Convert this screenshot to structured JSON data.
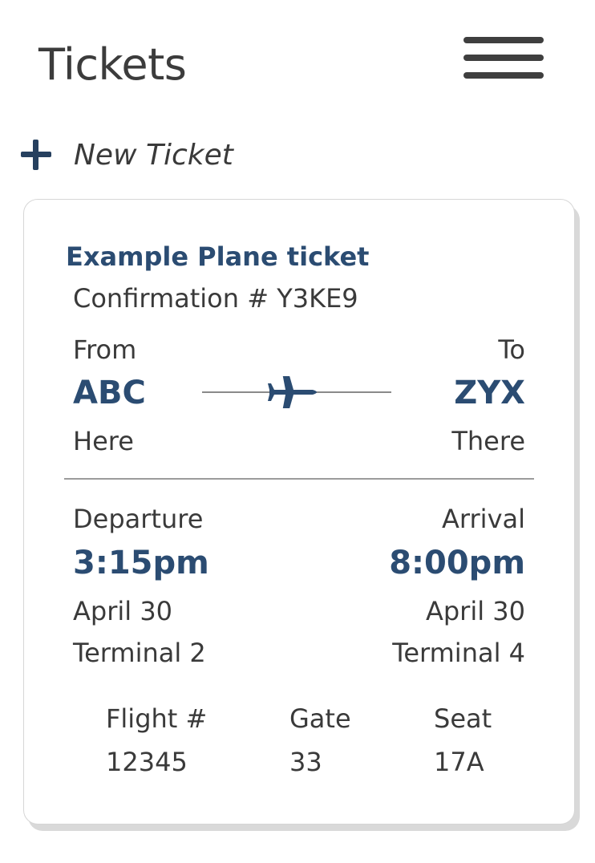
{
  "header": {
    "title": "Tickets",
    "menu_icon": "hamburger-menu-icon"
  },
  "actions": {
    "new_ticket_label": "New Ticket",
    "new_ticket_icon": "plus-icon"
  },
  "ticket": {
    "title": "Example Plane ticket",
    "confirmation": "Confirmation # Y3KE9",
    "from": {
      "label": "From",
      "code": "ABC",
      "city": "Here"
    },
    "to": {
      "label": "To",
      "code": "ZYX",
      "city": "There"
    },
    "route_icon": "airplane-icon",
    "departure": {
      "label": "Departure",
      "time": "3:15pm",
      "date": "April 30",
      "terminal": "Terminal 2"
    },
    "arrival": {
      "label": "Arrival",
      "time": "8:00pm",
      "date": "April 30",
      "terminal": "Terminal 4"
    },
    "details": {
      "flight_label": "Flight #",
      "flight_value": "12345",
      "gate_label": "Gate",
      "gate_value": "33",
      "seat_label": "Seat",
      "seat_value": "17A"
    }
  },
  "colors": {
    "accent": "#2b4c72",
    "text": "#3a3a3a",
    "divider": "#9c9c9c"
  }
}
